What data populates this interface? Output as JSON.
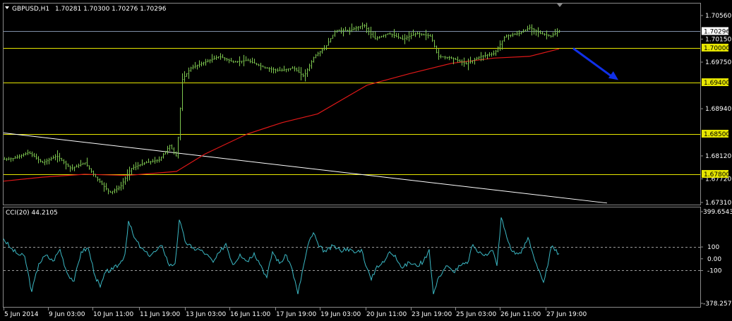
{
  "header": {
    "symbol_timeframe": "GBPUSD,H1",
    "ohlc": "1.70281 1.70300 1.70276 1.70296"
  },
  "indicator": {
    "label": "CCI(20) 44.2105",
    "ylim": [
      -378.2576,
      399.6543
    ]
  },
  "colors": {
    "background": "#000000",
    "candles": "#7ec850",
    "moving_average": "#e01818",
    "trendline": "#ffffff",
    "support_resistance": "#e6e600",
    "price_line": "#7f8fa8",
    "cci_line": "#3bb8c4",
    "arrow": "#1030e8"
  },
  "chart_data": [
    {
      "type": "candlestick",
      "series": [
        {
          "name": "GBPUSD,H1"
        },
        {
          "name": "moving_average"
        },
        {
          "name": "trendline"
        }
      ],
      "ylim": [
        1.6731,
        1.7056
      ],
      "price_ticks": [
        "1.70560",
        "1.70150",
        "1.69750",
        "1.68940",
        "1.68120",
        "1.67720",
        "1.67310"
      ],
      "x_ticks": [
        "5 Jun 2014",
        "9 Jun 03:00",
        "10 Jun 11:00",
        "11 Jun 19:00",
        "13 Jun 03:00",
        "16 Jun 11:00",
        "17 Jun 19:00",
        "19 Jun 03:00",
        "20 Jun 11:00",
        "23 Jun 19:00",
        "25 Jun 03:00",
        "26 Jun 11:00",
        "27 Jun 19:00"
      ],
      "current_price": "1.70296",
      "current_value": 1.70296,
      "horizontal_levels": [
        {
          "label": "1.70000",
          "value": 1.7
        },
        {
          "label": "1.69400",
          "value": 1.694
        },
        {
          "label": "1.68500",
          "value": 1.685
        },
        {
          "label": "1.67800",
          "value": 1.678
        }
      ],
      "price_path": [
        {
          "x": 0,
          "y": 1.6805
        },
        {
          "x": 20,
          "y": 1.6808
        },
        {
          "x": 40,
          "y": 1.6818
        },
        {
          "x": 60,
          "y": 1.68
        },
        {
          "x": 80,
          "y": 1.6812
        },
        {
          "x": 100,
          "y": 1.679
        },
        {
          "x": 120,
          "y": 1.68
        },
        {
          "x": 135,
          "y": 1.6775
        },
        {
          "x": 155,
          "y": 1.6748
        },
        {
          "x": 170,
          "y": 1.6758
        },
        {
          "x": 185,
          "y": 1.679
        },
        {
          "x": 205,
          "y": 1.68
        },
        {
          "x": 225,
          "y": 1.6805
        },
        {
          "x": 240,
          "y": 1.683
        },
        {
          "x": 250,
          "y": 1.681
        },
        {
          "x": 258,
          "y": 1.6945
        },
        {
          "x": 270,
          "y": 1.6965
        },
        {
          "x": 290,
          "y": 1.6975
        },
        {
          "x": 310,
          "y": 1.6985
        },
        {
          "x": 330,
          "y": 1.6975
        },
        {
          "x": 350,
          "y": 1.6978
        },
        {
          "x": 375,
          "y": 1.6965
        },
        {
          "x": 395,
          "y": 1.696
        },
        {
          "x": 415,
          "y": 1.6965
        },
        {
          "x": 430,
          "y": 1.695
        },
        {
          "x": 445,
          "y": 1.6985
        },
        {
          "x": 460,
          "y": 1.7
        },
        {
          "x": 475,
          "y": 1.703
        },
        {
          "x": 495,
          "y": 1.703
        },
        {
          "x": 515,
          "y": 1.704
        },
        {
          "x": 530,
          "y": 1.7015
        },
        {
          "x": 550,
          "y": 1.7025
        },
        {
          "x": 570,
          "y": 1.7015
        },
        {
          "x": 590,
          "y": 1.7025
        },
        {
          "x": 610,
          "y": 1.702
        },
        {
          "x": 620,
          "y": 1.6985
        },
        {
          "x": 640,
          "y": 1.6982
        },
        {
          "x": 660,
          "y": 1.6972
        },
        {
          "x": 680,
          "y": 1.6985
        },
        {
          "x": 700,
          "y": 1.699
        },
        {
          "x": 715,
          "y": 1.702
        },
        {
          "x": 735,
          "y": 1.7025
        },
        {
          "x": 750,
          "y": 1.7035
        },
        {
          "x": 765,
          "y": 1.7025
        },
        {
          "x": 780,
          "y": 1.702
        },
        {
          "x": 793,
          "y": 1.70296
        }
      ],
      "moving_average_path": [
        {
          "x": 5,
          "y": 1.6768
        },
        {
          "x": 60,
          "y": 1.6775
        },
        {
          "x": 120,
          "y": 1.678
        },
        {
          "x": 180,
          "y": 1.6778
        },
        {
          "x": 250,
          "y": 1.6785
        },
        {
          "x": 290,
          "y": 1.6815
        },
        {
          "x": 350,
          "y": 1.685
        },
        {
          "x": 400,
          "y": 1.687
        },
        {
          "x": 450,
          "y": 1.6885
        },
        {
          "x": 520,
          "y": 1.6935
        },
        {
          "x": 580,
          "y": 1.6955
        },
        {
          "x": 640,
          "y": 1.6973
        },
        {
          "x": 700,
          "y": 1.6982
        },
        {
          "x": 750,
          "y": 1.6985
        },
        {
          "x": 792,
          "y": 1.6998
        }
      ],
      "trendline_path": [
        {
          "x": 5,
          "y": 1.6852
        },
        {
          "x": 860,
          "y": 1.673
        }
      ],
      "arrow": {
        "x1": 812,
        "y1": 1.6999,
        "x2": 876,
        "y2": 1.6944
      }
    },
    {
      "type": "line",
      "series": [
        {
          "name": "CCI(20) 44.2105"
        }
      ],
      "ylim": [
        -378.2576,
        399.6543
      ],
      "y_ticks": [
        "399.6543",
        "100",
        "0.00",
        "-100",
        "-378.2576"
      ],
      "y_tick_values": [
        399.6543,
        100,
        0,
        -100,
        -378.2576
      ],
      "x_ticks": [
        "5 Jun 2014",
        "9 Jun 03:00",
        "10 Jun 11:00",
        "11 Jun 19:00",
        "13 Jun 03:00",
        "16 Jun 11:00",
        "17 Jun 19:00",
        "19 Jun 03:00",
        "20 Jun 11:00",
        "23 Jun 19:00",
        "25 Jun 03:00",
        "26 Jun 11:00",
        "27 Jun 19:00"
      ],
      "levels": [
        100,
        -100
      ],
      "values_path": [
        {
          "x": 5,
          "y": 170
        },
        {
          "x": 15,
          "y": 90
        },
        {
          "x": 25,
          "y": 40
        },
        {
          "x": 35,
          "y": 20
        },
        {
          "x": 45,
          "y": -280
        },
        {
          "x": 55,
          "y": -40
        },
        {
          "x": 65,
          "y": 30
        },
        {
          "x": 75,
          "y": -20
        },
        {
          "x": 85,
          "y": 80
        },
        {
          "x": 95,
          "y": -120
        },
        {
          "x": 105,
          "y": -190
        },
        {
          "x": 115,
          "y": 60
        },
        {
          "x": 125,
          "y": 90
        },
        {
          "x": 135,
          "y": -150
        },
        {
          "x": 142,
          "y": -240
        },
        {
          "x": 150,
          "y": -110
        },
        {
          "x": 160,
          "y": -90
        },
        {
          "x": 170,
          "y": -40
        },
        {
          "x": 177,
          "y": 40
        },
        {
          "x": 182,
          "y": 320
        },
        {
          "x": 190,
          "y": 180
        },
        {
          "x": 200,
          "y": 90
        },
        {
          "x": 210,
          "y": 30
        },
        {
          "x": 220,
          "y": 60
        },
        {
          "x": 230,
          "y": 110
        },
        {
          "x": 240,
          "y": -60
        },
        {
          "x": 248,
          "y": -40
        },
        {
          "x": 254,
          "y": 330
        },
        {
          "x": 262,
          "y": 150
        },
        {
          "x": 272,
          "y": 90
        },
        {
          "x": 282,
          "y": 80
        },
        {
          "x": 292,
          "y": 40
        },
        {
          "x": 302,
          "y": -30
        },
        {
          "x": 312,
          "y": 60
        },
        {
          "x": 320,
          "y": 130
        },
        {
          "x": 330,
          "y": -50
        },
        {
          "x": 340,
          "y": 40
        },
        {
          "x": 350,
          "y": -20
        },
        {
          "x": 360,
          "y": 50
        },
        {
          "x": 370,
          "y": -60
        },
        {
          "x": 378,
          "y": -160
        },
        {
          "x": 386,
          "y": 60
        },
        {
          "x": 396,
          "y": -40
        },
        {
          "x": 406,
          "y": 30
        },
        {
          "x": 414,
          "y": -90
        },
        {
          "x": 422,
          "y": -300
        },
        {
          "x": 430,
          "y": -60
        },
        {
          "x": 438,
          "y": 150
        },
        {
          "x": 444,
          "y": 220
        },
        {
          "x": 452,
          "y": 100
        },
        {
          "x": 462,
          "y": 60
        },
        {
          "x": 472,
          "y": 110
        },
        {
          "x": 482,
          "y": 70
        },
        {
          "x": 492,
          "y": 90
        },
        {
          "x": 502,
          "y": 50
        },
        {
          "x": 512,
          "y": 80
        },
        {
          "x": 520,
          "y": -80
        },
        {
          "x": 526,
          "y": -180
        },
        {
          "x": 534,
          "y": -60
        },
        {
          "x": 544,
          "y": -30
        },
        {
          "x": 552,
          "y": 60
        },
        {
          "x": 560,
          "y": 30
        },
        {
          "x": 570,
          "y": -80
        },
        {
          "x": 580,
          "y": -30
        },
        {
          "x": 590,
          "y": -60
        },
        {
          "x": 600,
          "y": -20
        },
        {
          "x": 608,
          "y": 80
        },
        {
          "x": 614,
          "y": -300
        },
        {
          "x": 622,
          "y": -150
        },
        {
          "x": 632,
          "y": -60
        },
        {
          "x": 642,
          "y": -110
        },
        {
          "x": 652,
          "y": -60
        },
        {
          "x": 662,
          "y": -40
        },
        {
          "x": 670,
          "y": 120
        },
        {
          "x": 678,
          "y": 50
        },
        {
          "x": 688,
          "y": 40
        },
        {
          "x": 698,
          "y": 70
        },
        {
          "x": 704,
          "y": -60
        },
        {
          "x": 710,
          "y": 350
        },
        {
          "x": 718,
          "y": 180
        },
        {
          "x": 726,
          "y": 60
        },
        {
          "x": 734,
          "y": 40
        },
        {
          "x": 742,
          "y": 90
        },
        {
          "x": 748,
          "y": 180
        },
        {
          "x": 756,
          "y": 20
        },
        {
          "x": 764,
          "y": -100
        },
        {
          "x": 770,
          "y": -200
        },
        {
          "x": 776,
          "y": -60
        },
        {
          "x": 781,
          "y": 100
        },
        {
          "x": 786,
          "y": 70
        },
        {
          "x": 792,
          "y": 44
        }
      ]
    }
  ]
}
